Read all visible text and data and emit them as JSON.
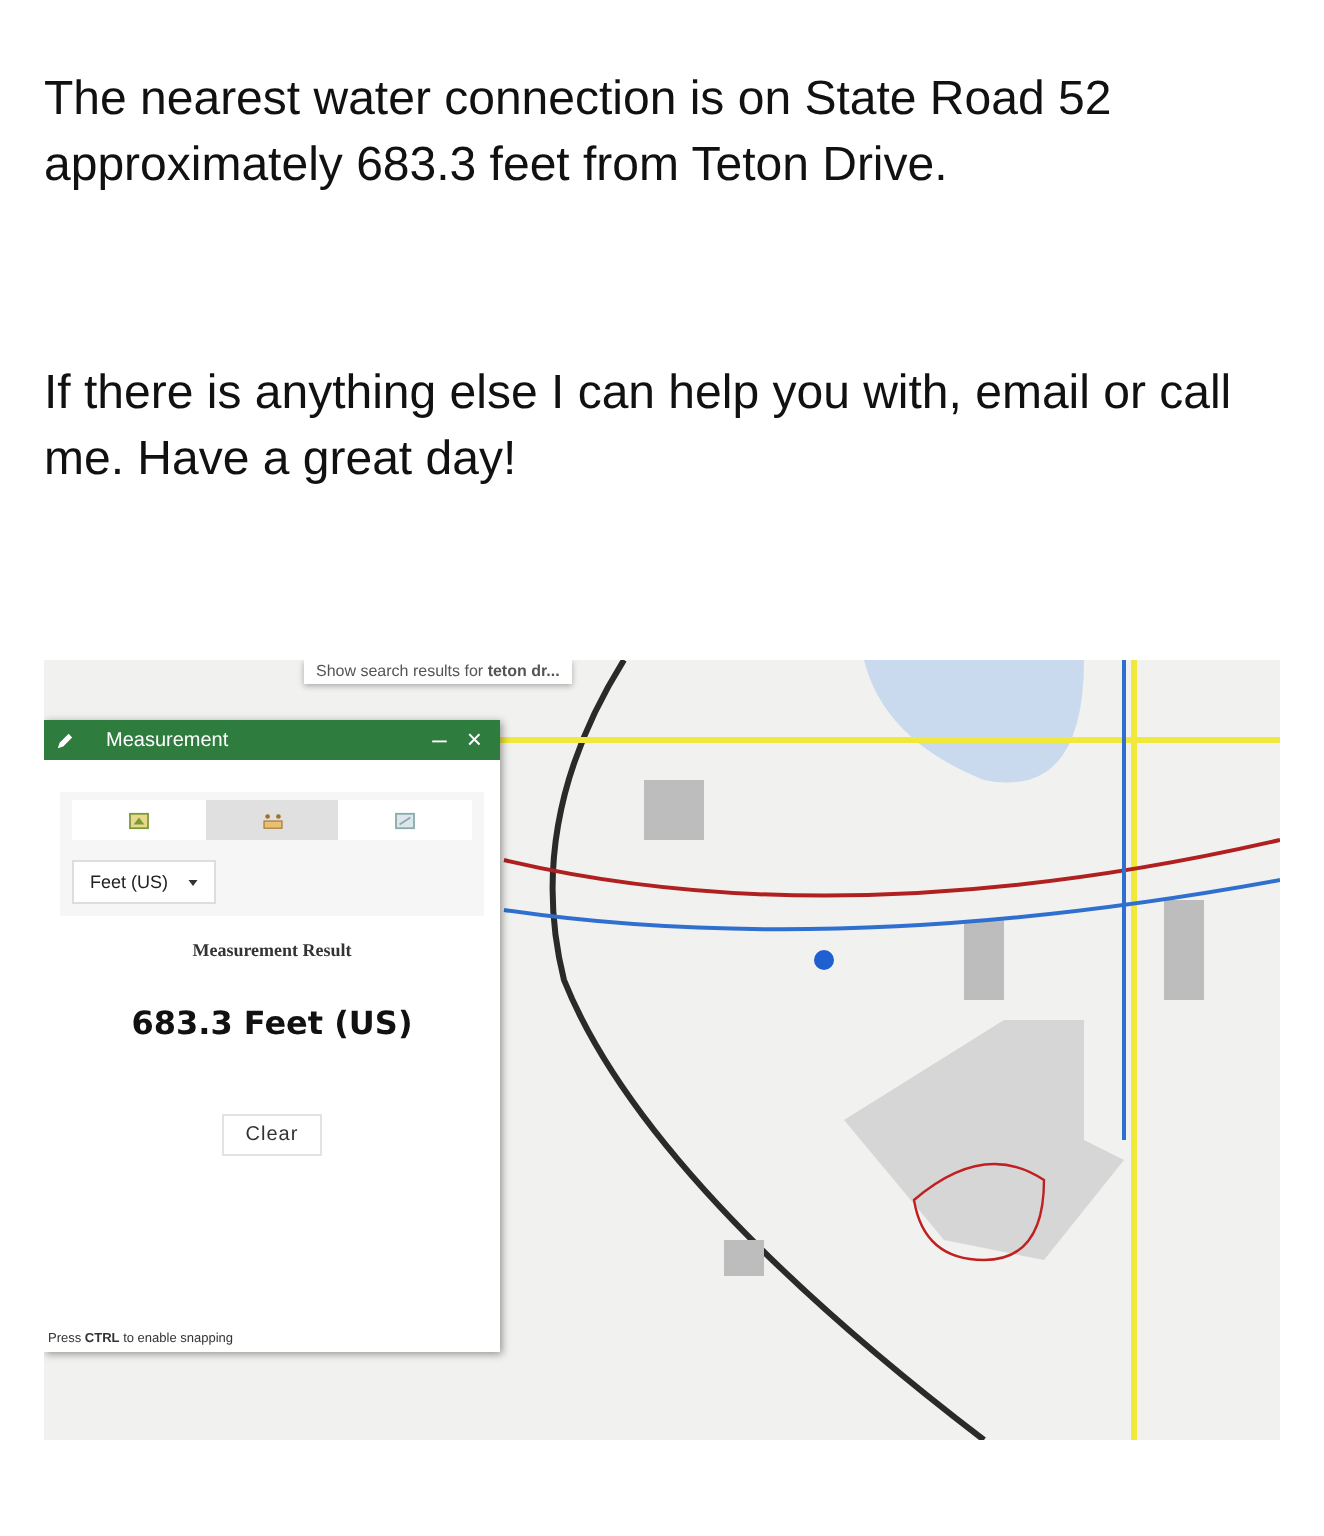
{
  "paragraphs": [
    "The nearest water connection is on State Road 52 approximately 683.3 feet from Teton Drive.",
    "If there is anything else I can help you with, email or call me. Have a great day!"
  ],
  "map": {
    "kind": "picture"
  },
  "search_popup": {
    "text": "Show search results for **teton dr...**"
  },
  "panel": {
    "title": "Measurement",
    "minimize": "–",
    "close": "×",
    "tabs": [
      {
        "kind": "area",
        "selected": false
      },
      {
        "kind": "distance",
        "selected": true
      },
      {
        "kind": "location",
        "selected": false
      }
    ],
    "unit_select": {
      "value": "Feet (US)"
    },
    "result_label": "Measurement Result",
    "result_value": "683.3 Feet (US)",
    "clear_button": "Clear",
    "hint": "Press **CTRL** to enable snapping"
  }
}
